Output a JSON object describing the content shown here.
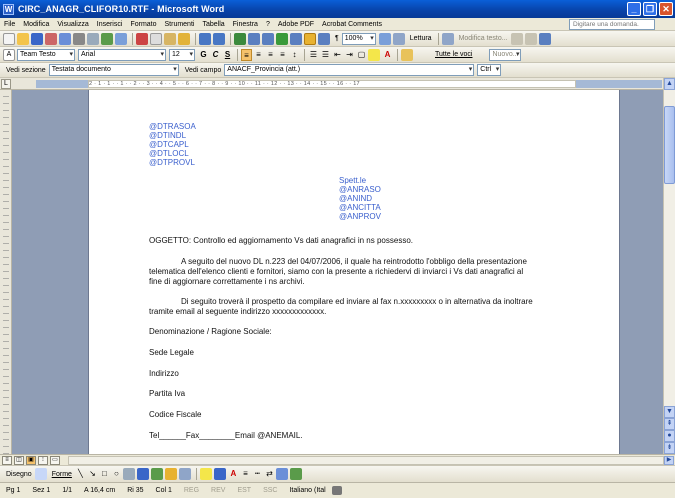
{
  "window": {
    "title": "CIRC_ANAGR_CLIFOR10.RTF - Microsoft Word",
    "app_icon": "W"
  },
  "menu": {
    "items": [
      "File",
      "Modifica",
      "Visualizza",
      "Inserisci",
      "Formato",
      "Strumenti",
      "Tabella",
      "Finestra",
      "?",
      "Adobe PDF",
      "Acrobat Comments"
    ],
    "help_placeholder": "Digitare una domanda."
  },
  "toolbar_standard": {
    "zoom": "100%",
    "reading_label": "Lettura",
    "markup_label": "Modifica testo..."
  },
  "toolbar_format": {
    "style": "Team Testo",
    "font": "Arial",
    "size": "12",
    "bold": "G",
    "italic": "C",
    "underline": "S",
    "all_entries": "Tutte le voci",
    "new_label": "Nuovo..."
  },
  "toolbar_mailmerge": {
    "section_label": "Vedi sezione",
    "section_value": "Testata documento",
    "field_label": "Vedi campo",
    "field_value": "ANACF_Provincia (att.)",
    "ctrl_label": "Ctrl"
  },
  "ruler": {
    "marks": "2 · 1 · 1 · · 1 · · 2 · · 3 · · 4 · · 5 · · 6 · · 7 · · 8 · · 9 · · 10 · · 11 · · 12 · · 13 · · 14 · · 15 · · 16 · · 17"
  },
  "document": {
    "header_fields": [
      "@DTRASOA",
      "@DTINDL",
      "@DTCAPL",
      "@DTLOCL",
      "@DTPROVL"
    ],
    "addressee_label": "Spett.le",
    "addressee_fields": [
      "@ANRASO",
      "@ANIND",
      "@ANCITTA",
      "@ANPROV"
    ],
    "subject": "OGGETTO: Controllo ed aggiornamento Vs dati anagrafici in ns possesso.",
    "para1_line1": "A seguito del nuovo DL n.223 del 04/07/2006, il quale ha reintrodotto l'obbligo della presentazione",
    "para1_line2": "telematica dell'elenco clienti e fornitori, siamo con la presente a richiedervi di inviarci i  Vs dati anagrafici al",
    "para1_line3": "fine di aggiornare correttamente i ns archivi.",
    "para2_line1": "Di seguito troverà il prospetto da compilare ed inviare al fax n.xxxxxxxxx o in alternativa da inoltrare",
    "para2_line2": "tramite email al seguente indirizzo xxxxxxxxxxxxx.",
    "form_labels": [
      "Denominazione / Ragione Sociale:",
      "Sede Legale",
      "Indirizzo",
      "Partita Iva",
      "Codice Fiscale"
    ],
    "contact_line": "Tel______Fax________Email @ANEMAIL."
  },
  "drawbar": {
    "draw_label": "Disegno",
    "shapes_label": "Forme"
  },
  "status": {
    "page": "Pg 1",
    "section": "Sez 1",
    "pages": "1/1",
    "position": "A 16,4 cm",
    "line": "Ri 35",
    "col": "Col 1",
    "rec": "REG",
    "rev": "REV",
    "est": "EST",
    "ssc": "SSC",
    "language": "Italiano (Ital"
  },
  "colors": {
    "titlebar": "#0a5fd8",
    "field_text": "#3a5fcd",
    "doc_background": "#8f9db5"
  }
}
